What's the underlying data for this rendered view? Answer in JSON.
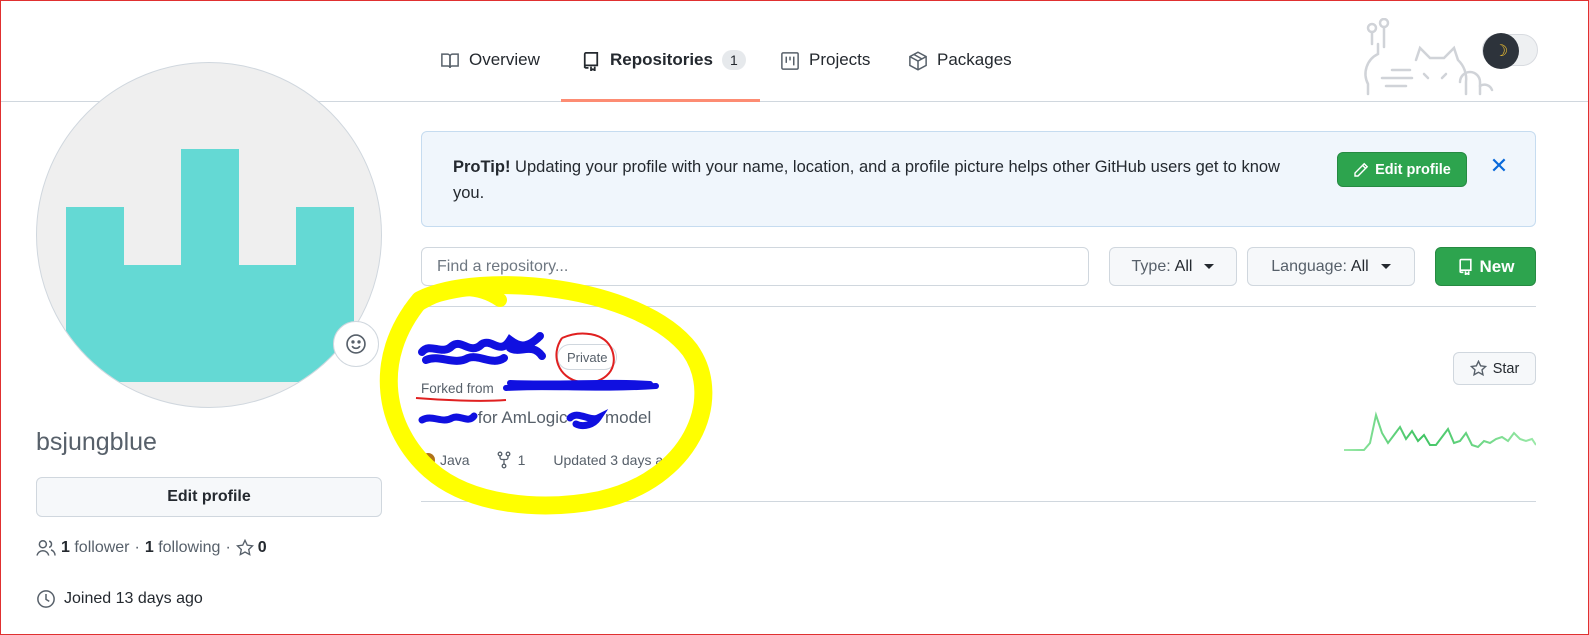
{
  "nav": {
    "tabs": [
      {
        "label": "Overview",
        "icon": "book-icon"
      },
      {
        "label": "Repositories",
        "icon": "repo-icon",
        "count": "1",
        "selected": true
      },
      {
        "label": "Projects",
        "icon": "project-icon"
      },
      {
        "label": "Packages",
        "icon": "package-icon"
      }
    ],
    "theme_icon": "moon-icon"
  },
  "profile": {
    "username": "bsjungblue",
    "edit_profile_label": "Edit profile",
    "followers_count": "1",
    "followers_label": "follower",
    "following_count": "1",
    "following_label": "following",
    "stars_count": "0",
    "separator": "·",
    "joined": "Joined 13 days ago",
    "avatar_color": "#64d9d4"
  },
  "protip": {
    "title": "ProTip!",
    "text": "Updating your profile with your name, location, and a profile picture helps other GitHub users get to know you.",
    "button_label": "Edit profile",
    "close_icon": "close-icon"
  },
  "filters": {
    "search_placeholder": "Find a repository...",
    "type_label": "Type:",
    "type_value": "All",
    "language_label": "Language:",
    "language_value": "All",
    "new_label": "New"
  },
  "repo": {
    "name": "",
    "visibility": "Private",
    "forked_from_label": "Forked from",
    "description_middle": "for AmLogic",
    "description_end": "model",
    "language": "Java",
    "language_color": "#b07219",
    "forks": "1",
    "updated": "Updated 3 days ago",
    "star_label": "Star"
  },
  "colors": {
    "accent_green": "#2da44e",
    "link_blue": "#0969da",
    "tab_underline": "#fd8c73",
    "annotation_yellow": "#ffff00",
    "annotation_red": "#e02020",
    "scribble_blue": "#1010e0"
  }
}
